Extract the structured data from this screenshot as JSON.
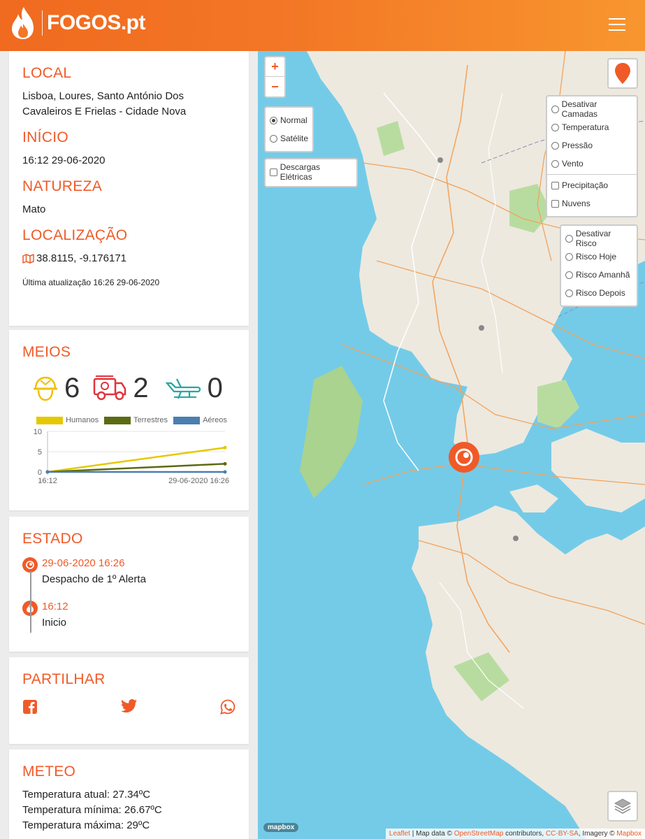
{
  "header": {
    "logo_text": "FOGOS.pt",
    "menu_icon": "hamburger-icon"
  },
  "info": {
    "local_title": "LOCAL",
    "local_value": "Lisboa, Loures, Santo António Dos Cavaleiros E Frielas - Cidade Nova",
    "inicio_title": "INÍCIO",
    "inicio_value": "16:12 29-06-2020",
    "natureza_title": "NATUREZA",
    "natureza_value": "Mato",
    "localizacao_title": "LOCALIZAÇÃO",
    "localizacao_value": "38.8115, -9.176171",
    "last_update": "Última atualização 16:26 29-06-2020"
  },
  "meios": {
    "title": "MEIOS",
    "humanos": "6",
    "terrestres": "2",
    "aereos": "0"
  },
  "chart_data": {
    "type": "line",
    "x": [
      "16:12",
      "29-06-2020 16:26"
    ],
    "ylim": [
      0,
      10
    ],
    "yticks": [
      "10",
      "5",
      "0"
    ],
    "series": [
      {
        "name": "Humanos",
        "values": [
          0,
          6
        ],
        "color": "#e6c800"
      },
      {
        "name": "Terrestres",
        "values": [
          0,
          2
        ],
        "color": "#5b6b12"
      },
      {
        "name": "Aéreos",
        "values": [
          0,
          0
        ],
        "color": "#4a7fb0"
      }
    ]
  },
  "estado": {
    "title": "ESTADO",
    "events": [
      {
        "time": "29-06-2020 16:26",
        "desc": "Despacho de 1º Alerta"
      },
      {
        "time": "16:12",
        "desc": "Inicio"
      }
    ]
  },
  "partilhar": {
    "title": "PARTILHAR"
  },
  "meteo": {
    "title": "METEO",
    "temp_atual": "Temperatura atual: 27.34ºC",
    "temp_min": "Temperatura mínima: 26.67ºC",
    "temp_max": "Temperatura máxima: 29ºC"
  },
  "map": {
    "zoom_in": "+",
    "zoom_out": "−",
    "base_layers": [
      "Normal",
      "Satélite"
    ],
    "base_selected": "Normal",
    "lightning": "Descargas Elétricas",
    "weather_layers": [
      "Desativar Camadas",
      "Temperatura",
      "Pressão",
      "Vento"
    ],
    "weather_checks": [
      "Precipitação",
      "Nuvens"
    ],
    "risk_layers": [
      "Desativar Risco",
      "Risco Hoje",
      "Risco Amanhã",
      "Risco Depois"
    ],
    "attribution_leaflet": "Leaflet",
    "attribution_mid": " | Map data © ",
    "attribution_osm": "OpenStreetMap",
    "attribution_contrib": " contributors, ",
    "attribution_cc": "CC-BY-SA",
    "attribution_imagery": ", Imagery © ",
    "attribution_mapbox": "Mapbox",
    "mapbox_logo": "mapbox",
    "colors": {
      "water": "#74cbe8",
      "land": "#ede9df",
      "green": "#a9d38e",
      "accent": "#f05a28"
    }
  }
}
